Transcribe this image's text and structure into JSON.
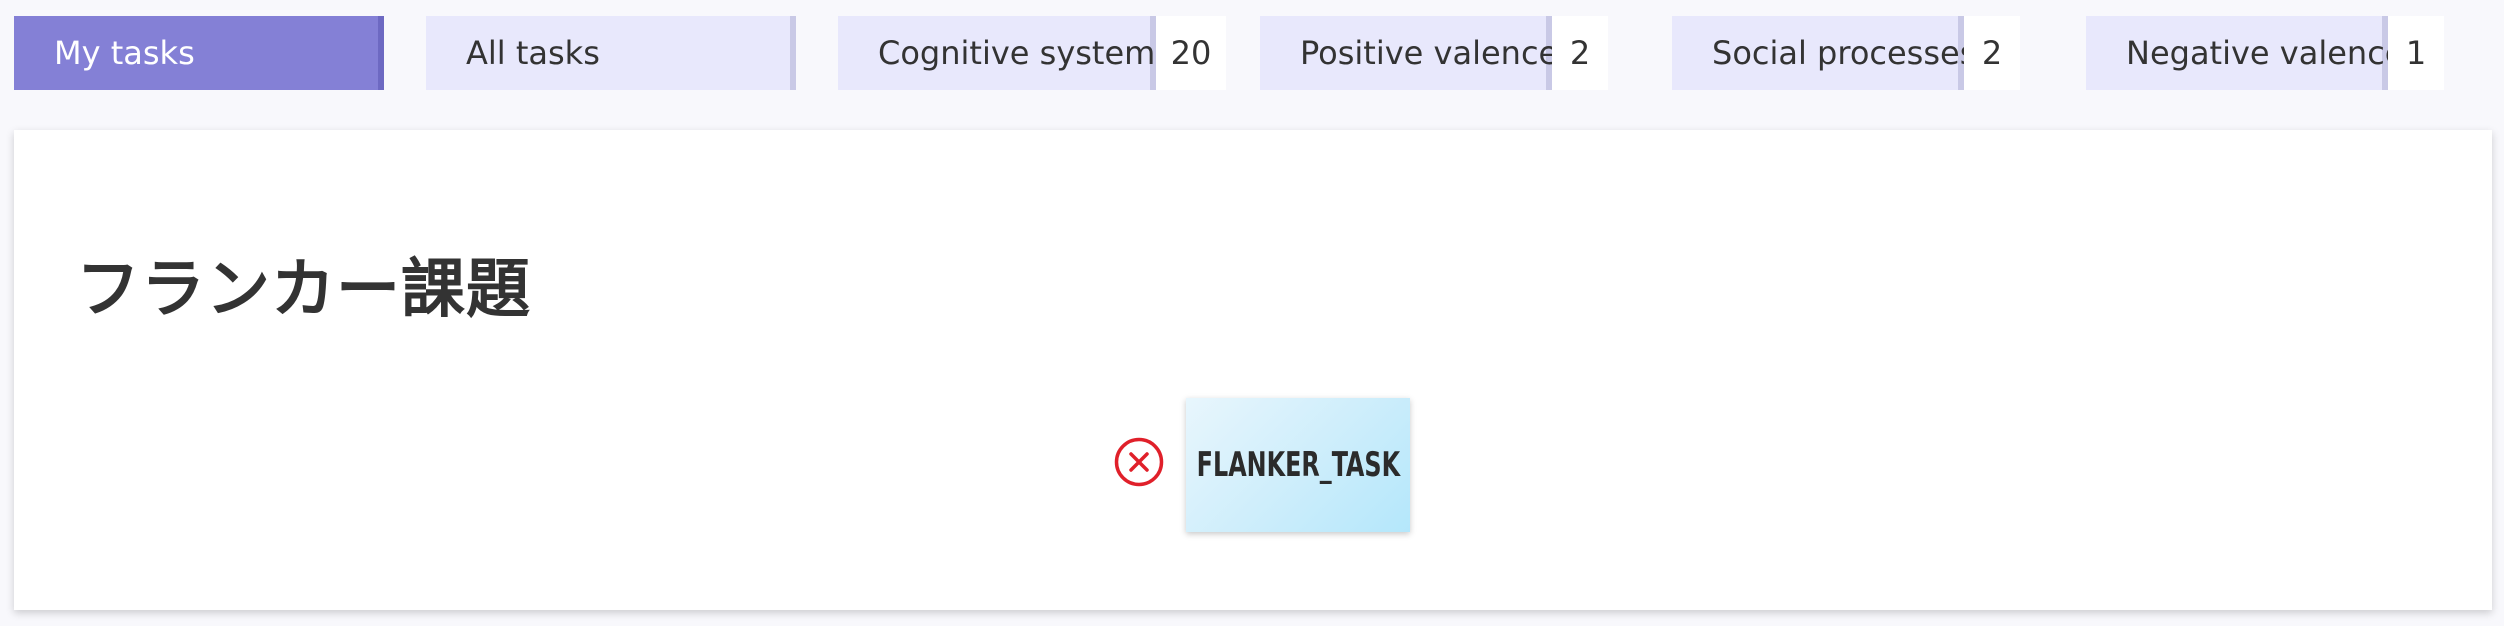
{
  "tabs": [
    {
      "label": "My tasks",
      "active": true
    },
    {
      "label": "All tasks",
      "active": false
    },
    {
      "label": "Cognitive systems",
      "count": "20",
      "active": false
    },
    {
      "label": "Positive valence",
      "count": "2",
      "active": false
    },
    {
      "label": "Social processes",
      "count": "2",
      "active": false
    },
    {
      "label": "Negative valence",
      "count": "1",
      "active": false
    }
  ],
  "card": {
    "title": "フランカー課題",
    "task": {
      "name": "FLANKER_TASK",
      "remove_icon": "close-circle-icon",
      "remove_color": "#e0202a"
    }
  },
  "colors": {
    "active_tab": "#8480d6",
    "inactive_tab": "#e8e8fc",
    "task_chip": "#b4e7fb"
  }
}
